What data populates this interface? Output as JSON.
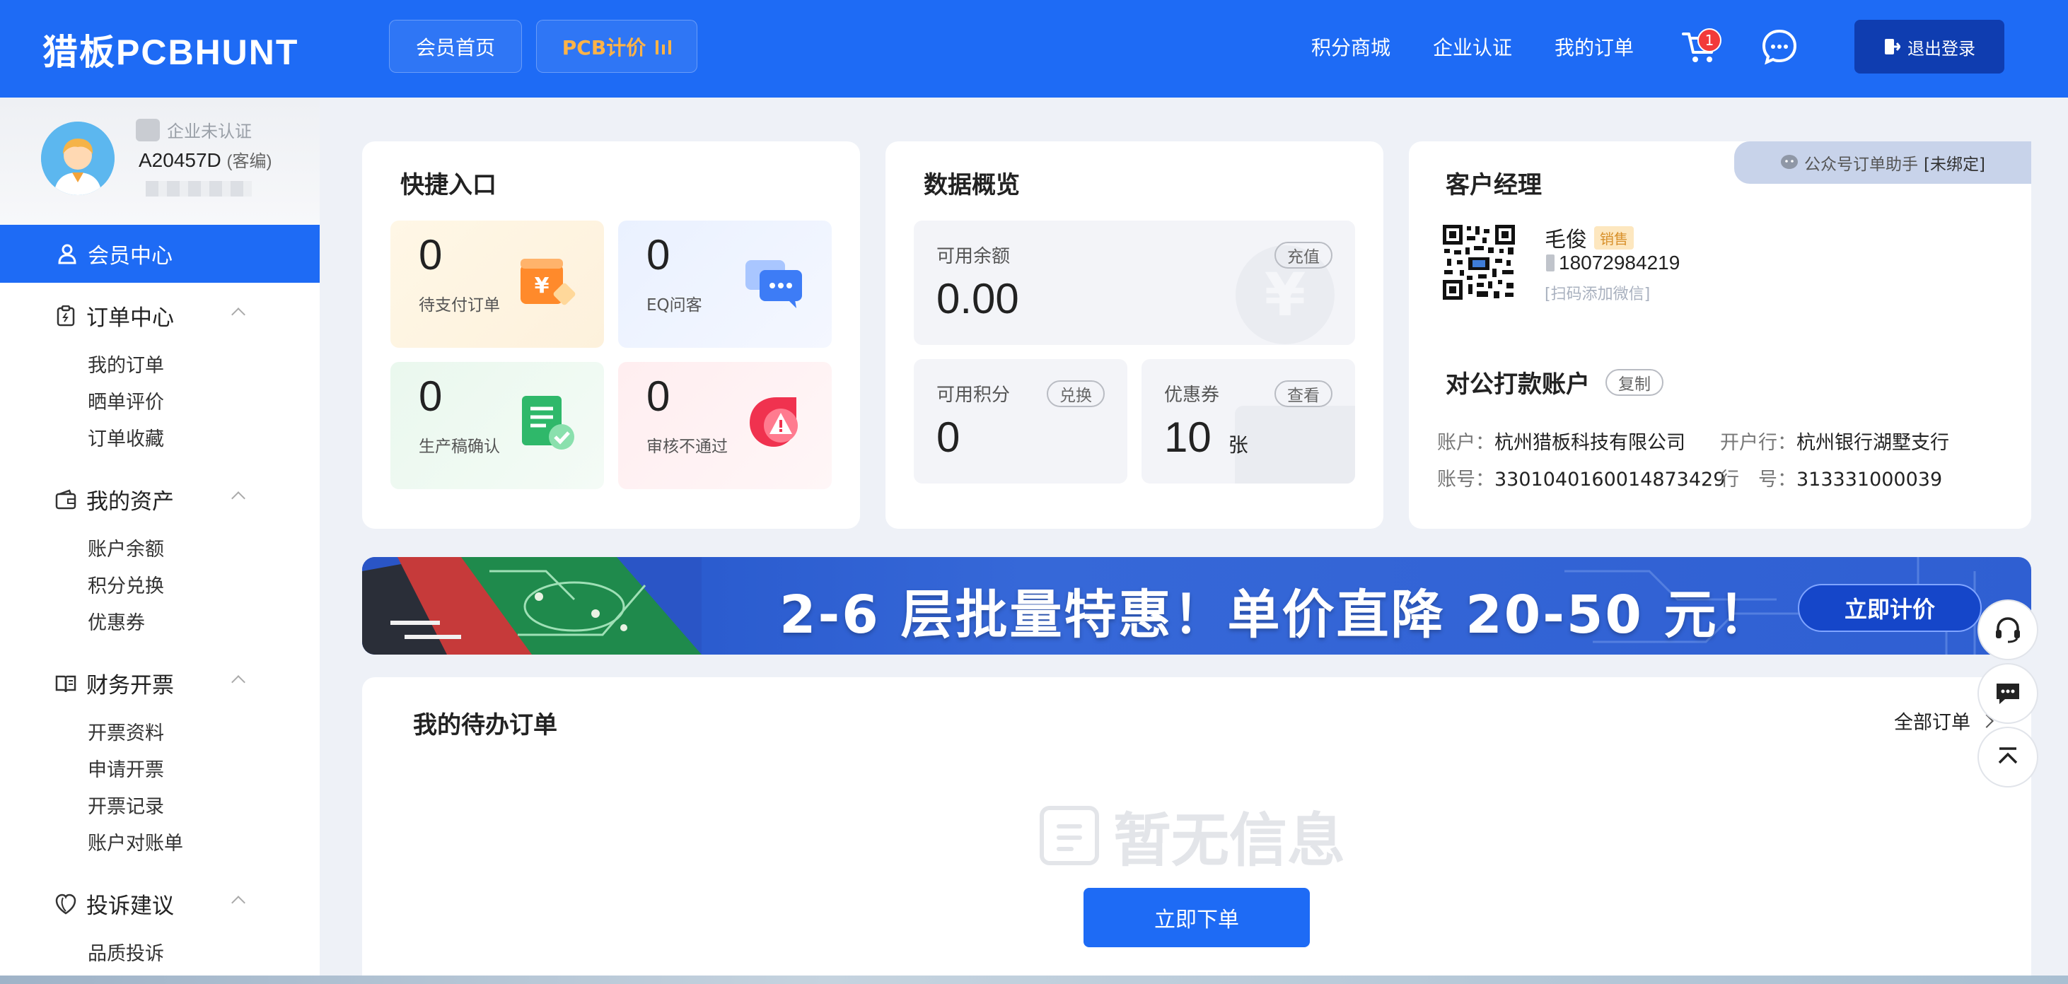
{
  "header": {
    "logo": "猎板PCBHUNT",
    "nav_home": "会员首页",
    "nav_pcb": "PCB计价",
    "links": [
      "积分商城",
      "企业认证",
      "我的订单"
    ],
    "cart_count": "1",
    "logout": "退出登录",
    "brand_color": "#1e6bf5"
  },
  "profile": {
    "cert_status": "企业未认证",
    "user_id": "A20457D",
    "edit": "(客编)"
  },
  "sidebar": {
    "active": "会员中心",
    "groups": [
      {
        "title": "订单中心",
        "items": [
          "我的订单",
          "晒单评价",
          "订单收藏"
        ]
      },
      {
        "title": "我的资产",
        "items": [
          "账户余额",
          "积分兑换",
          "优惠券"
        ]
      },
      {
        "title": "财务开票",
        "items": [
          "开票资料",
          "申请开票",
          "开票记录",
          "账户对账单"
        ]
      },
      {
        "title": "投诉建议",
        "items": [
          "品质投诉"
        ]
      }
    ]
  },
  "quick": {
    "title": "快捷入口",
    "tiles": [
      {
        "num": "0",
        "label": "待支付订单",
        "icon": "payment-icon"
      },
      {
        "num": "0",
        "label": "EQ问客",
        "icon": "chat-bubble-icon"
      },
      {
        "num": "0",
        "label": "生产稿确认",
        "icon": "document-check-icon"
      },
      {
        "num": "0",
        "label": "审核不通过",
        "icon": "warning-icon"
      }
    ]
  },
  "overview": {
    "title": "数据概览",
    "balance_label": "可用余额",
    "balance_value": "0.00",
    "recharge": "充值",
    "points_label": "可用积分",
    "points_value": "0",
    "exchange": "兑换",
    "coupon_label": "优惠券",
    "coupon_value": "10",
    "coupon_unit": "张",
    "view": "查看"
  },
  "manager": {
    "title": "客户经理",
    "assistant": "公众号订单助手",
    "assistant_status": "[未绑定]",
    "name": "毛俊",
    "tag": "销售",
    "phone": "18072984219",
    "hint": "[扫码添加微信]",
    "account_title": "对公打款账户",
    "copy": "复制",
    "account_label": "账户：",
    "account_value": "杭州猎板科技有限公司",
    "bank_label": "开户行：",
    "bank_value": "杭州银行湖墅支行",
    "number_label": "账号：",
    "number_value": "3301040160014873429",
    "code_label": "行　号：",
    "code_value": "313331000039"
  },
  "banner": {
    "text": "2-6 层批量特惠！单价直降 20-50 元！",
    "button": "立即计价"
  },
  "todo": {
    "title": "我的待办订单",
    "all": "全部订单",
    "empty": "暂无信息",
    "order_button": "立即下单"
  }
}
